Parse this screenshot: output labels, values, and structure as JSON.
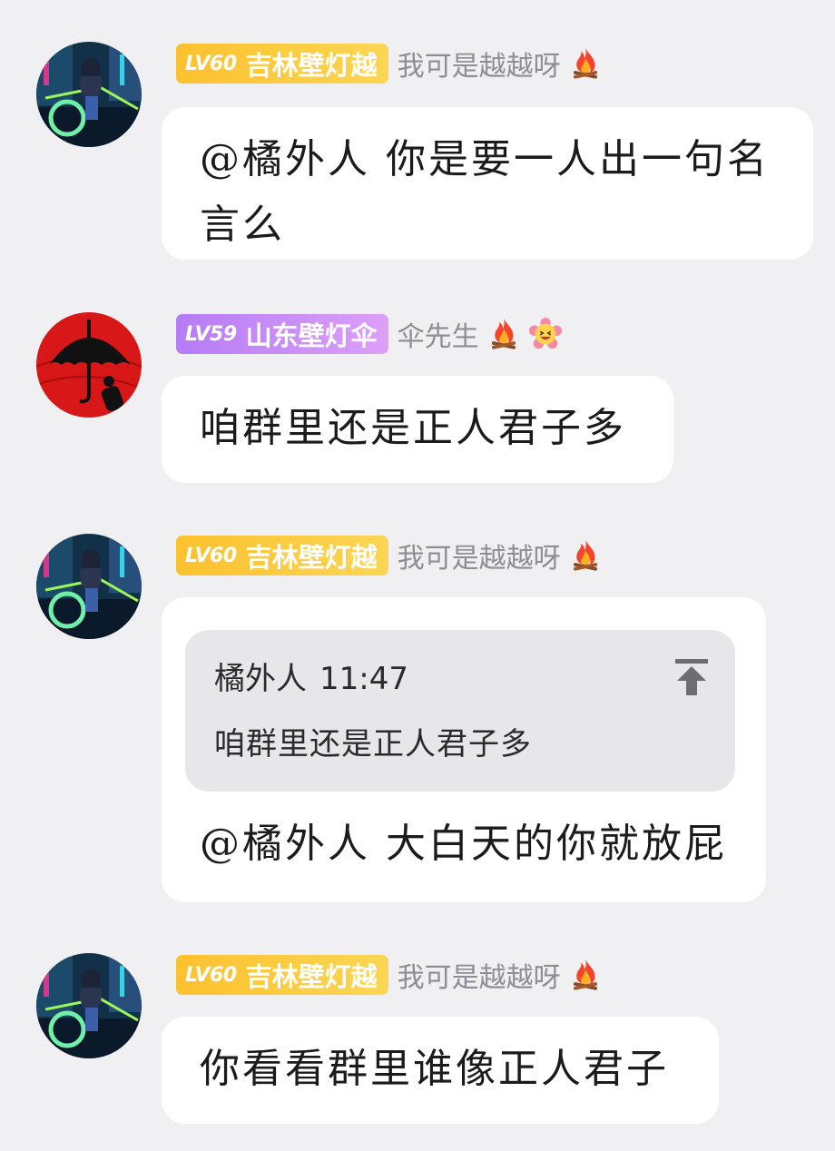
{
  "messages": [
    {
      "level": "LV60",
      "badge_name": "吉林壁灯越",
      "nickname": "我可是越越呀",
      "text": "@橘外人 你是要一人出一句名言么"
    },
    {
      "level": "LV59",
      "badge_name": "山东壁灯伞",
      "nickname": "伞先生",
      "text": "咱群里还是正人君子多"
    },
    {
      "level": "LV60",
      "badge_name": "吉林壁灯越",
      "nickname": "我可是越越呀",
      "quote": {
        "author": "橘外人",
        "time": "11:47",
        "text": "咱群里还是正人君子多"
      },
      "text": "@橘外人 大白天的你就放屁"
    },
    {
      "level": "LV60",
      "badge_name": "吉林壁灯越",
      "nickname": "我可是越越呀",
      "text": "你看看群里谁像正人君子"
    }
  ],
  "icons": {
    "fire": "fire-emoji",
    "laugh": "laughing-flower-emoji",
    "jump": "jump-to-quote-icon"
  },
  "colors": {
    "background": "#f0f0f2",
    "badge_gold": "#fcc12e",
    "badge_purple": "#b57cf6",
    "nickname": "#8d8d93",
    "quote_bg": "#e7e7ea"
  }
}
